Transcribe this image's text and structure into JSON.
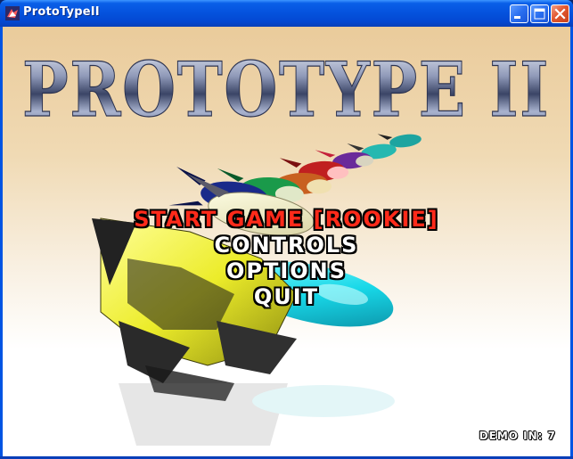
{
  "window": {
    "title": "ProtoTypeII",
    "buttons": {
      "minimize": "minimize-icon",
      "maximize": "maximize-icon",
      "close": "close-icon"
    }
  },
  "game": {
    "logo_text": "PROTOTYPE II",
    "menu": {
      "items": [
        {
          "label": "START GAME [ROOKIE]",
          "selected": true
        },
        {
          "label": "CONTROLS",
          "selected": false
        },
        {
          "label": "OPTIONS",
          "selected": false
        },
        {
          "label": "QUIT",
          "selected": false
        }
      ]
    },
    "demo_countdown": "DEMO IN: 7",
    "colors": {
      "selected": "#ff2a1a",
      "normal": "#ffffff",
      "outline": "#000000"
    }
  }
}
